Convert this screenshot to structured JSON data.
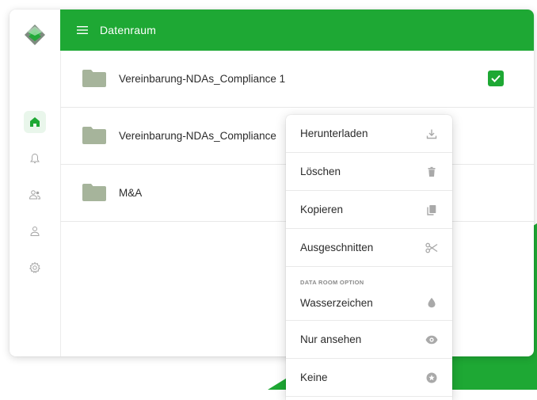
{
  "header": {
    "title": "Datenraum"
  },
  "sidebar": {
    "items": [
      {
        "name": "home",
        "icon": "home-icon",
        "active": true
      },
      {
        "name": "notifications",
        "icon": "bell-icon",
        "active": false
      },
      {
        "name": "groups",
        "icon": "users-icon",
        "active": false
      },
      {
        "name": "profile",
        "icon": "user-icon",
        "active": false
      },
      {
        "name": "settings",
        "icon": "gear-icon",
        "active": false
      }
    ]
  },
  "files": [
    {
      "name": "Vereinbarung-NDAs_Compliance 1",
      "checked": true
    },
    {
      "name": "Vereinbarung-NDAs_Compliance",
      "checked": false
    },
    {
      "name": "M&A",
      "checked": false
    }
  ],
  "context_menu": {
    "items": [
      {
        "label": "Herunterladen",
        "icon": "download-icon"
      },
      {
        "label": "Löschen",
        "icon": "trash-icon"
      },
      {
        "label": "Kopieren",
        "icon": "copy-icon"
      },
      {
        "label": "Ausgeschnitten",
        "icon": "scissors-icon"
      },
      {
        "label": "Wasserzeichen",
        "icon": "drop-icon",
        "section": "DATA ROOM OPTION"
      },
      {
        "label": "Nur ansehen",
        "icon": "eye-icon"
      },
      {
        "label": "Keine",
        "icon": "star-circle-icon"
      }
    ]
  },
  "colors": {
    "brand_green": "#1ea834",
    "folder": "#a6b49b",
    "menu_icon": "#a9a9a9",
    "text": "#2b2b2b"
  }
}
